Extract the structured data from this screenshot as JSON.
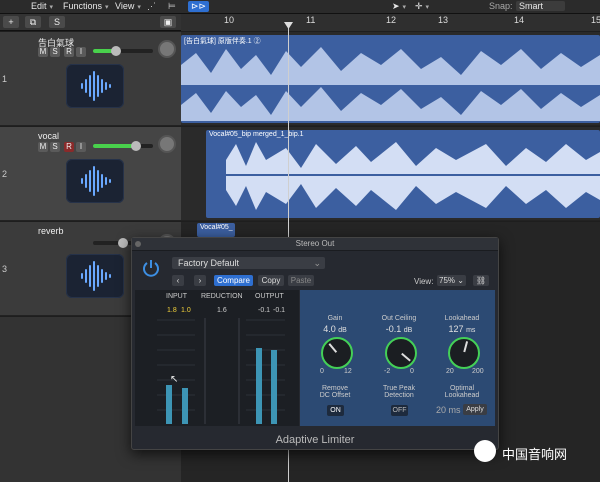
{
  "menu": {
    "items": [
      "Edit",
      "Functions",
      "View"
    ]
  },
  "toolbar": {
    "add": "+",
    "s": "S",
    "snap_label": "Snap:",
    "snap_value": "Smart"
  },
  "ruler": {
    "marks": [
      "10",
      "11",
      "12",
      "13",
      "14",
      "15"
    ]
  },
  "tracks": [
    {
      "num": "1",
      "name": "告白氣球",
      "m": "M",
      "s": "S",
      "r": "R",
      "i": "I",
      "region": "[告白氣球] 原版伴奏.1  ②"
    },
    {
      "num": "2",
      "name": "vocal",
      "m": "M",
      "s": "S",
      "r": "R",
      "i": "I",
      "region": "Vocal#05_bip merged_1_bip.1"
    },
    {
      "num": "3",
      "name": "reverb",
      "region": "Vocal#05_"
    }
  ],
  "plugin": {
    "window_title": "Stereo Out",
    "preset": "Factory Default",
    "compare": "Compare",
    "copy": "Copy",
    "paste": "Paste",
    "view_label": "View:",
    "view_value": "75%",
    "meter_heads": {
      "input": "INPUT",
      "reduction": "REDUCTION",
      "output": "OUTPUT"
    },
    "peaks": {
      "in_l": "1.8",
      "in_r": "1.0",
      "red": "1.6",
      "out_l": "-0.1",
      "out_r": "-0.1"
    },
    "gain": {
      "label": "Gain",
      "value": "4.0",
      "unit": "dB",
      "min": "0",
      "max": "12"
    },
    "ceiling": {
      "label": "Out Ceiling",
      "value": "-0.1",
      "unit": "dB",
      "min": "-2",
      "max": "0"
    },
    "lookahead": {
      "label": "Lookahead",
      "value": "127",
      "unit": "ms",
      "min": "20",
      "max": "200"
    },
    "dc": {
      "label1": "Remove",
      "label2": "DC Offset",
      "state": "ON"
    },
    "truepeak": {
      "label1": "True Peak",
      "label2": "Detection",
      "state": "OFF"
    },
    "optimal": {
      "label1": "Optimal",
      "label2": "Lookahead",
      "value": "20 ms",
      "apply": "Apply"
    },
    "name": "Adaptive Limiter"
  },
  "watermark": "中国音响网",
  "colors": {
    "accent": "#44d057",
    "region": "#3c5fa0",
    "blue_button": "#2e6fd1"
  }
}
